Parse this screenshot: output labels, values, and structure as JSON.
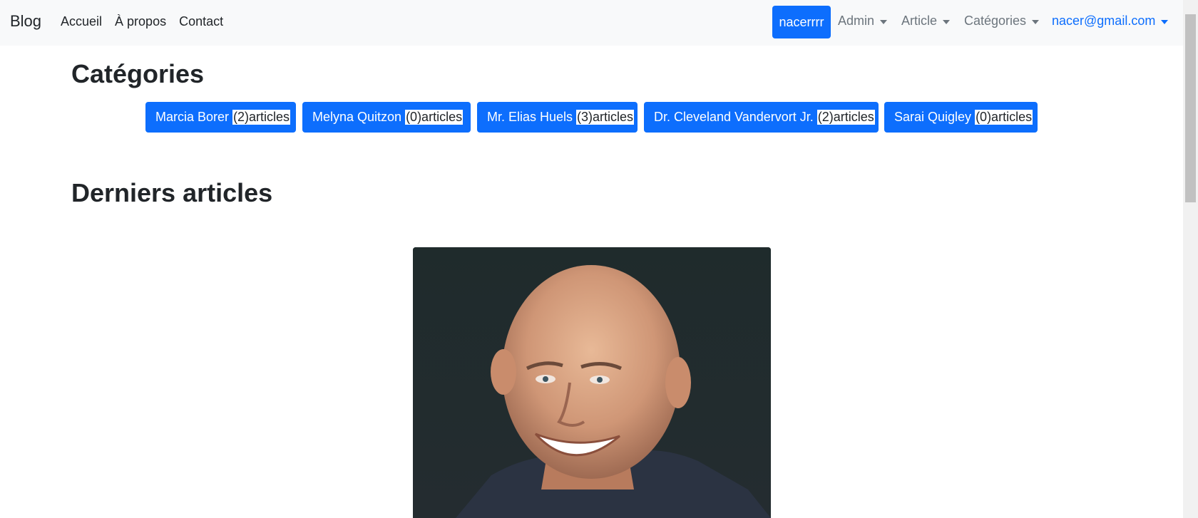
{
  "navbar": {
    "brand": "Blog",
    "links": [
      "Accueil",
      "À propos",
      "Contact"
    ],
    "user_button": "nacerrrr",
    "menus": [
      "Admin",
      "Article",
      "Catégories"
    ],
    "email_menu": "nacer@gmail.com"
  },
  "categories_section": {
    "title": "Catégories",
    "buttons": [
      {
        "name": "Marcia Borer",
        "count": "(2)articles"
      },
      {
        "name": "Melyna Quitzon",
        "count": "(0)articles"
      },
      {
        "name": "Mr. Elias Huels",
        "count": "(3)articles"
      },
      {
        "name": "Dr. Cleveland Vandervort Jr.",
        "count": "(2)articles"
      },
      {
        "name": "Sarai Quigley",
        "count": "(0)articles"
      }
    ]
  },
  "articles_section": {
    "title": "Derniers articles"
  },
  "colors": {
    "primary": "#0d6efd",
    "navbar_bg": "#f8f9fa",
    "muted_text": "#6c757d"
  }
}
